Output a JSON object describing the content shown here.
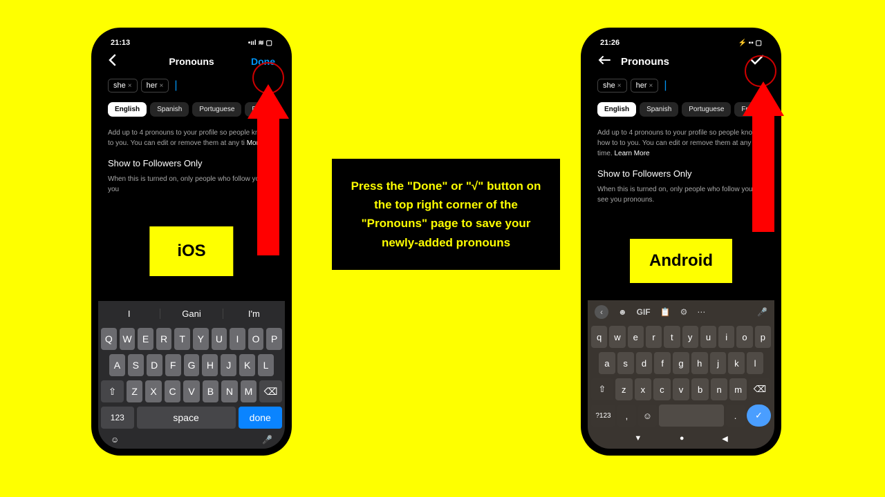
{
  "ios": {
    "time": "21:13",
    "status_extra": "▣ ◉",
    "signal": "▪▪▪▪",
    "wifi": "◈",
    "battery": "▮▯",
    "nav_title": "Pronouns",
    "done": "Done",
    "chips": [
      "she",
      "her"
    ],
    "langs": [
      "English",
      "Spanish",
      "Portuguese",
      "Fr"
    ],
    "info": "Add up to 4 pronouns to your profile so people kn refer to you. You can edit or remove them at any ti",
    "learn_more": "More",
    "section": "Show to Followers Only",
    "sub": "When this is turned on, only people who follow you wi you",
    "os_label": "iOS",
    "suggestions": [
      "I",
      "Gani",
      "I'm"
    ],
    "row1": [
      "Q",
      "W",
      "E",
      "R",
      "T",
      "Y",
      "U",
      "I",
      "O",
      "P"
    ],
    "row2": [
      "A",
      "S",
      "D",
      "F",
      "G",
      "H",
      "J",
      "K",
      "L"
    ],
    "row3_mid": [
      "Z",
      "X",
      "C",
      "V",
      "B",
      "N",
      "M"
    ],
    "key_123": "123",
    "key_space": "space",
    "key_done": "done"
  },
  "android": {
    "time": "21:26",
    "status_extra": "▣ ◉",
    "signal": "📶",
    "battery": "▮",
    "nav_title": "Pronouns",
    "chips": [
      "she",
      "her"
    ],
    "langs": [
      "English",
      "Spanish",
      "Portuguese",
      "French"
    ],
    "info": "Add up to 4 pronouns to your profile so people know how to to you. You can edit or remove them at any time.",
    "learn_more": "Learn More",
    "section": "Show to Followers Only",
    "sub": "When this is turned on, only people who follow you will see you pronouns.",
    "os_label": "Android",
    "gif": "GIF",
    "row1": [
      "q",
      "w",
      "e",
      "r",
      "t",
      "y",
      "u",
      "i",
      "o",
      "p"
    ],
    "row2": [
      "a",
      "s",
      "d",
      "f",
      "g",
      "h",
      "j",
      "k",
      "l"
    ],
    "row3_mid": [
      "z",
      "x",
      "c",
      "v",
      "b",
      "n",
      "m"
    ],
    "key_123": "?123"
  },
  "instruction": "Press the \"Done\" or \"√\" button on the top right corner of the \"Pronouns\" page to save your newly-added pronouns"
}
